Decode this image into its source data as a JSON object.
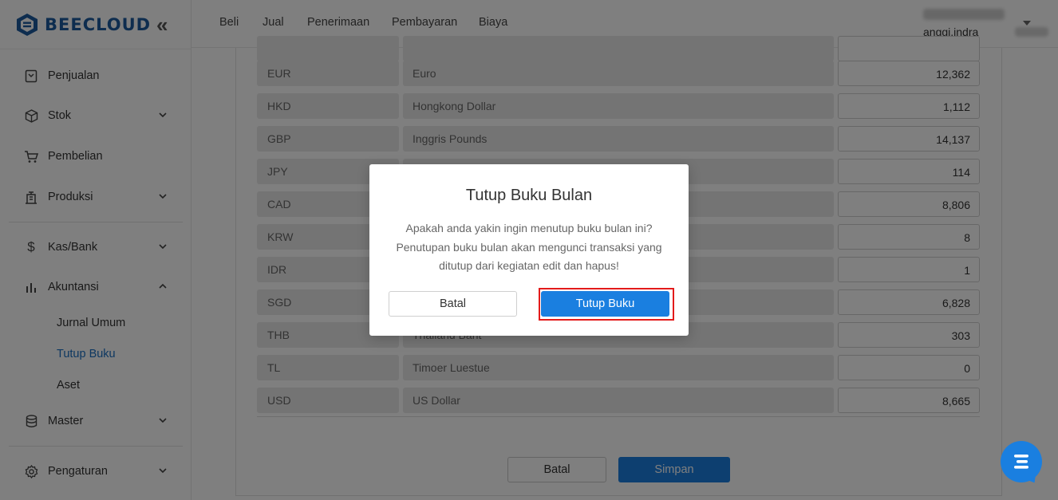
{
  "brand": {
    "name": "BEECLOUD"
  },
  "sidebar": {
    "items": [
      {
        "label": "Penjualan",
        "icon": "invoice-icon"
      },
      {
        "label": "Stok",
        "icon": "box-icon"
      },
      {
        "label": "Pembelian",
        "icon": "cart-icon"
      },
      {
        "label": "Produksi",
        "icon": "factory-icon"
      },
      {
        "label": "Kas/Bank",
        "icon": "dollar-icon"
      },
      {
        "label": "Akuntansi",
        "icon": "chart-bars-icon"
      },
      {
        "label": "Master",
        "icon": "database-icon"
      },
      {
        "label": "Pengaturan",
        "icon": "gear-icon"
      }
    ],
    "akuntansi_sub": [
      "Jurnal Umum",
      "Tutup Buku",
      "Aset"
    ]
  },
  "topbar": {
    "menu": [
      "Beli",
      "Jual",
      "Penerimaan",
      "Pembayaran",
      "Biaya"
    ],
    "user_email": "anggi.indra"
  },
  "currency_table": [
    {
      "code": "EUR",
      "name": "Euro",
      "rate": "12,362"
    },
    {
      "code": "HKD",
      "name": "Hongkong Dollar",
      "rate": "1,112"
    },
    {
      "code": "GBP",
      "name": "Inggris Pounds",
      "rate": "14,137"
    },
    {
      "code": "JPY",
      "name": "",
      "rate": "114"
    },
    {
      "code": "CAD",
      "name": "",
      "rate": "8,806"
    },
    {
      "code": "KRW",
      "name": "",
      "rate": "8"
    },
    {
      "code": "IDR",
      "name": "",
      "rate": "1"
    },
    {
      "code": "SGD",
      "name": "",
      "rate": "6,828"
    },
    {
      "code": "THB",
      "name": "Thailand Baht",
      "rate": "303"
    },
    {
      "code": "TL",
      "name": "Timoer Luestue",
      "rate": "0"
    },
    {
      "code": "USD",
      "name": "US Dollar",
      "rate": "8,665"
    }
  ],
  "form_buttons": {
    "cancel": "Batal",
    "save": "Simpan"
  },
  "modal": {
    "title": "Tutup Buku Bulan",
    "line1": "Apakah anda yakin ingin menutup buku bulan ini?",
    "line2": "Penutupan buku bulan akan mengunci transaksi yang",
    "line3": "ditutup dari kegiatan edit dan hapus!",
    "cancel": "Batal",
    "confirm": "Tutup Buku"
  },
  "colors": {
    "accent": "#1a7fe0",
    "brand": "#1d5b9e",
    "highlight": "#e31b1b",
    "active_link": "#1a6fc2"
  }
}
